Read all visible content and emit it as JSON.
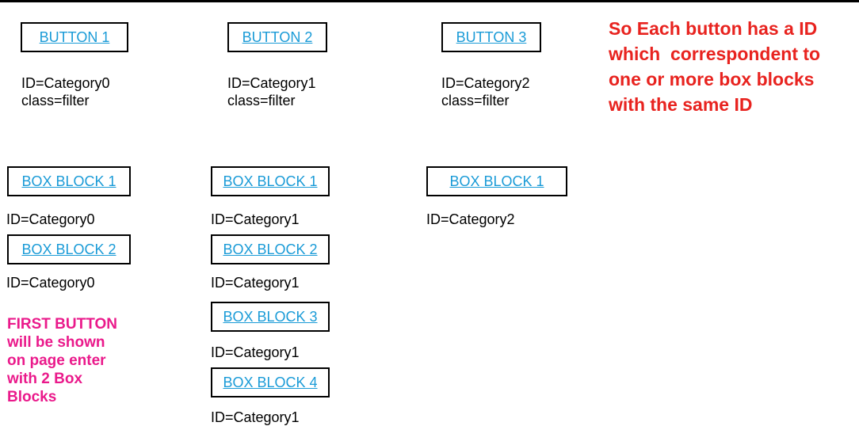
{
  "colors": {
    "link_blue": "#1a9bd7",
    "note_red": "#e8231f",
    "note_magenta": "#ea1a8b",
    "border": "#000000"
  },
  "buttons": [
    {
      "label": "BUTTON 1",
      "id_text": "ID=Category0",
      "class_text": "class=filter"
    },
    {
      "label": "BUTTON 2",
      "id_text": "ID=Category1",
      "class_text": "class=filter"
    },
    {
      "label": "BUTTON 3",
      "id_text": "ID=Category2",
      "class_text": "class=filter"
    }
  ],
  "box_columns": [
    {
      "blocks": [
        {
          "label": "BOX BLOCK 1",
          "id_text": "ID=Category0"
        },
        {
          "label": "BOX BLOCK 2",
          "id_text": "ID=Category0"
        }
      ]
    },
    {
      "blocks": [
        {
          "label": "BOX BLOCK 1",
          "id_text": "ID=Category1"
        },
        {
          "label": "BOX BLOCK 2",
          "id_text": "ID=Category1"
        },
        {
          "label": "BOX BLOCK 3",
          "id_text": "ID=Category1"
        },
        {
          "label": "BOX BLOCK 4",
          "id_text": "ID=Category1"
        }
      ]
    },
    {
      "blocks": [
        {
          "label": "BOX BLOCK 1",
          "id_text": "ID=Category2"
        }
      ]
    }
  ],
  "notes": {
    "red_lines": [
      "So Each button has a ID",
      "which  correspondent to",
      "one or more box blocks",
      "with the same ID"
    ],
    "magenta_lines": [
      "FIRST BUTTON",
      "will be shown",
      "on page enter",
      "with 2 Box",
      "Blocks"
    ]
  }
}
